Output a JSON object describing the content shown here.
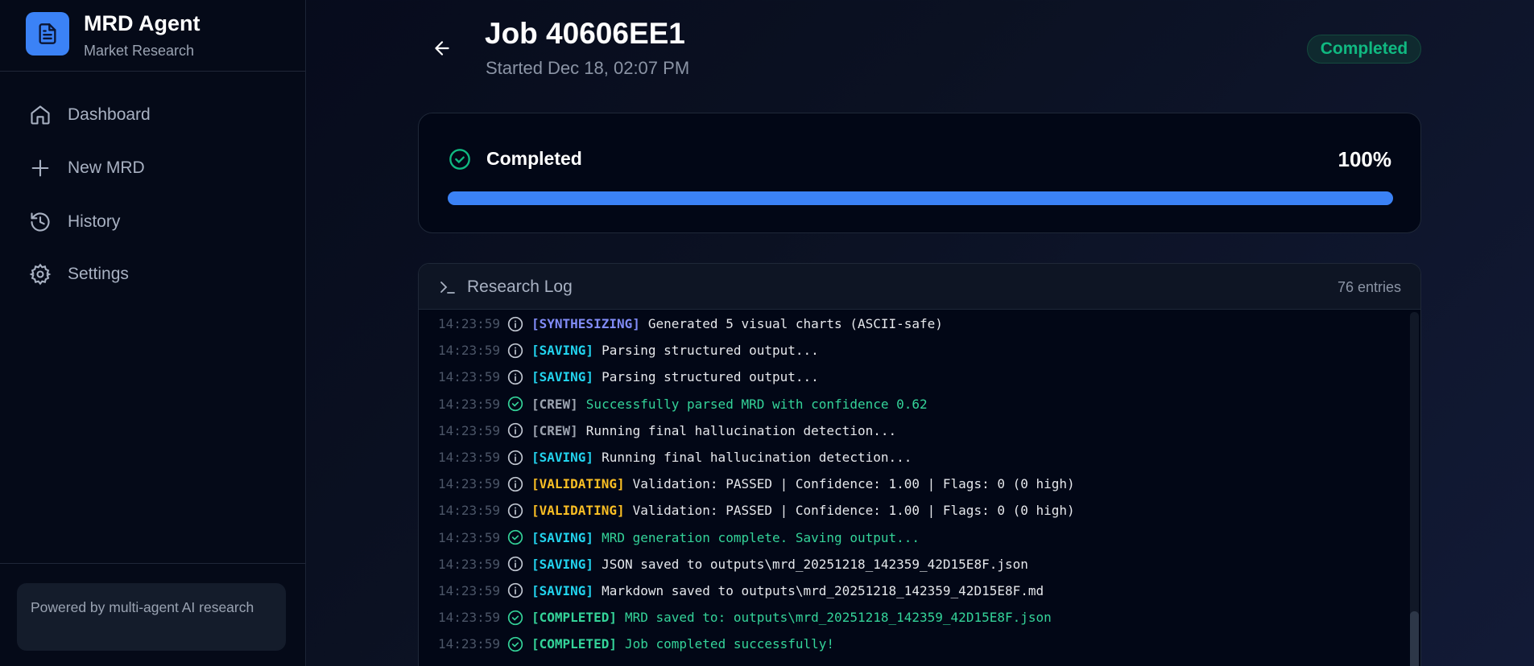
{
  "sidebar": {
    "title": "MRD Agent",
    "subtitle": "Market Research",
    "items": [
      {
        "label": "Dashboard",
        "icon": "home-icon"
      },
      {
        "label": "New MRD",
        "icon": "plus-icon"
      },
      {
        "label": "History",
        "icon": "history-icon"
      },
      {
        "label": "Settings",
        "icon": "gear-icon"
      }
    ],
    "footer": "Powered by multi-agent AI research"
  },
  "header": {
    "title": "Job 40606EE1",
    "subtitle": "Started Dec 18, 02:07 PM",
    "status": "Completed"
  },
  "progress": {
    "label": "Completed",
    "percent_label": "100%",
    "value": 100
  },
  "log": {
    "title": "Research Log",
    "count": "76 entries",
    "rows": [
      {
        "time": "14:23:59",
        "type": "info",
        "tag": "[SYNTHESIZING]",
        "tag_color": "#818cf8",
        "msg": "Generated 5 visual charts (ASCII-safe)"
      },
      {
        "time": "14:23:59",
        "type": "info",
        "tag": "[SAVING]",
        "tag_color": "#22d3ee",
        "msg": "Parsing structured output..."
      },
      {
        "time": "14:23:59",
        "type": "info",
        "tag": "[SAVING]",
        "tag_color": "#22d3ee",
        "msg": "Parsing structured output..."
      },
      {
        "time": "14:23:59",
        "type": "success",
        "tag": "[CREW]",
        "tag_color": "#9ca3af",
        "msg": "Successfully parsed MRD with confidence 0.62"
      },
      {
        "time": "14:23:59",
        "type": "info",
        "tag": "[CREW]",
        "tag_color": "#9ca3af",
        "msg": "Running final hallucination detection..."
      },
      {
        "time": "14:23:59",
        "type": "info",
        "tag": "[SAVING]",
        "tag_color": "#22d3ee",
        "msg": "Running final hallucination detection..."
      },
      {
        "time": "14:23:59",
        "type": "info",
        "tag": "[VALIDATING]",
        "tag_color": "#fbbf24",
        "msg": "Validation: PASSED | Confidence: 1.00 | Flags: 0 (0 high)"
      },
      {
        "time": "14:23:59",
        "type": "info",
        "tag": "[VALIDATING]",
        "tag_color": "#fbbf24",
        "msg": "Validation: PASSED | Confidence: 1.00 | Flags: 0 (0 high)"
      },
      {
        "time": "14:23:59",
        "type": "success",
        "tag": "[SAVING]",
        "tag_color": "#22d3ee",
        "msg": "MRD generation complete. Saving output..."
      },
      {
        "time": "14:23:59",
        "type": "info",
        "tag": "[SAVING]",
        "tag_color": "#22d3ee",
        "msg": "JSON saved to outputs\\mrd_20251218_142359_42D15E8F.json"
      },
      {
        "time": "14:23:59",
        "type": "info",
        "tag": "[SAVING]",
        "tag_color": "#22d3ee",
        "msg": "Markdown saved to outputs\\mrd_20251218_142359_42D15E8F.md"
      },
      {
        "time": "14:23:59",
        "type": "success",
        "tag": "[COMPLETED]",
        "tag_color": "#34d399",
        "msg": "MRD saved to: outputs\\mrd_20251218_142359_42D15E8F.json"
      },
      {
        "time": "14:23:59",
        "type": "success",
        "tag": "[COMPLETED]",
        "tag_color": "#34d399",
        "msg": "Job completed successfully!"
      }
    ]
  },
  "colors": {
    "accent": "#3b82f6",
    "success": "#10b981",
    "info_text": "#e5e7eb",
    "success_text": "#34d399"
  }
}
